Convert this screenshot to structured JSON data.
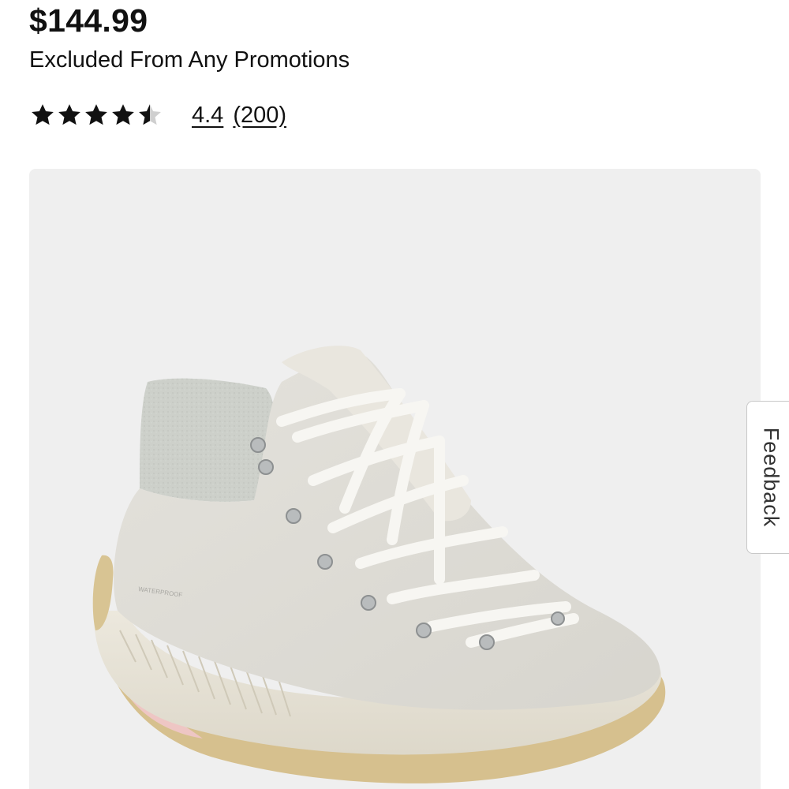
{
  "product": {
    "price": "$144.99",
    "promo_note": "Excluded From Any Promotions",
    "rating": {
      "stars_value": 4.4,
      "value_text": "4.4",
      "count_text": "(200)",
      "star_color": "#111111",
      "star_empty_color": "#cfcfcf"
    },
    "image": {
      "alt": "Sorel hiking boot in off-white with gray felt collar",
      "background": "#efefef",
      "print_text": "WATERPROOF"
    }
  },
  "feedback": {
    "label": "Feedback"
  }
}
